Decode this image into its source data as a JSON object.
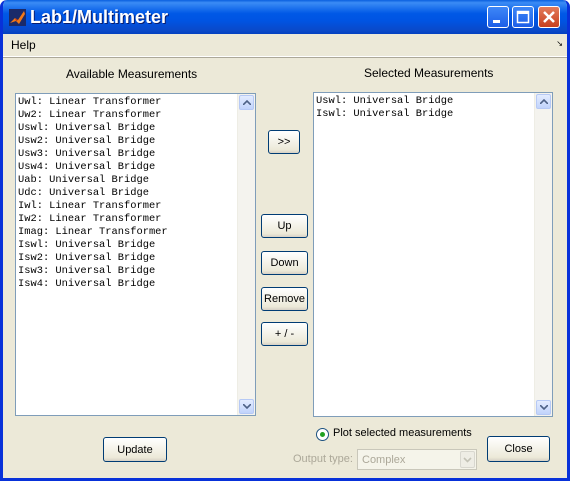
{
  "window": {
    "title": "Lab1/Multimeter"
  },
  "menu": {
    "help": "Help"
  },
  "available": {
    "heading": "Available Measurements",
    "items": [
      "Uwl: Linear Transformer",
      "Uw2: Linear Transformer",
      "Uswl: Universal Bridge",
      "Usw2: Universal Bridge",
      "Usw3: Universal Bridge",
      "Usw4: Universal Bridge",
      "Uab: Universal Bridge",
      "Udc: Universal Bridge",
      "Iwl: Linear Transformer",
      "Iw2: Linear Transformer",
      "Imag: Linear Transformer",
      "Iswl: Universal Bridge",
      "Isw2: Universal Bridge",
      "Isw3: Universal Bridge",
      "Isw4: Universal Bridge"
    ]
  },
  "selected": {
    "heading": "Selected Measurements",
    "items": [
      "Uswl: Universal Bridge",
      "Iswl: Universal Bridge"
    ]
  },
  "buttons": {
    "add": ">>",
    "up": "Up",
    "down": "Down",
    "remove": "Remove",
    "sign": "+ / -",
    "update": "Update",
    "close": "Close"
  },
  "plot_option": {
    "label": "Plot selected measurements",
    "checked": true
  },
  "output_type": {
    "label": "Output type:",
    "value": "Complex"
  },
  "colors": {
    "titlebar": "#0054e3",
    "face": "#ece9d8",
    "radio_dot": "#21a121"
  }
}
